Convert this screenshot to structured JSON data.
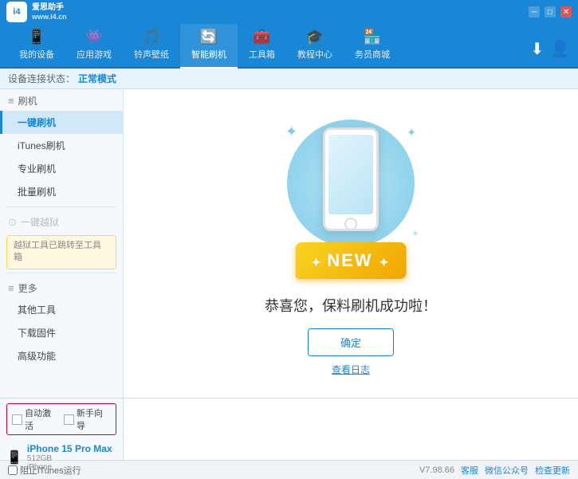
{
  "titleBar": {
    "logoText1": "爱思助手",
    "logoText2": "www.i4.cn",
    "logoCode": "i4",
    "controls": [
      "minimize",
      "maximize",
      "close"
    ]
  },
  "nav": {
    "items": [
      {
        "id": "my-device",
        "icon": "📱",
        "label": "我的设备"
      },
      {
        "id": "apps-games",
        "icon": "🎮",
        "label": "应用游戏"
      },
      {
        "id": "ringtones",
        "icon": "🎵",
        "label": "铃声壁纸"
      },
      {
        "id": "smart-flash",
        "icon": "🔄",
        "label": "智能刷机",
        "active": true
      },
      {
        "id": "toolbox",
        "icon": "🧰",
        "label": "工具箱"
      },
      {
        "id": "tutorials",
        "icon": "🎓",
        "label": "教程中心"
      },
      {
        "id": "service",
        "icon": "🏪",
        "label": "务员商城"
      }
    ],
    "rightIcons": [
      "download",
      "user"
    ]
  },
  "statusBar": {
    "label": "设备连接状态：",
    "value": "正常模式"
  },
  "sidebar": {
    "sections": [
      {
        "header": "刷机",
        "items": [
          {
            "id": "one-click-flash",
            "label": "一键刷机",
            "active": true
          },
          {
            "id": "itunes-flash",
            "label": "iTunes刷机"
          },
          {
            "id": "pro-flash",
            "label": "专业刷机"
          },
          {
            "id": "batch-flash",
            "label": "批量刷机"
          }
        ]
      },
      {
        "header": "一键越狱",
        "disabled": true,
        "notice": "越狱工具已跳转至工具箱"
      },
      {
        "header": "更多",
        "items": [
          {
            "id": "other-tools",
            "label": "其他工具"
          },
          {
            "id": "download-firmware",
            "label": "下载固件"
          },
          {
            "id": "advanced",
            "label": "高级功能"
          }
        ]
      }
    ]
  },
  "content": {
    "successText": "恭喜您，保料刷机成功啦！",
    "confirmButton": "确定",
    "logLink": "查看日志",
    "newBadgeText": "NEW",
    "phone": {
      "altText": "phone illustration"
    }
  },
  "bottomPanel": {
    "checkboxes": [
      {
        "id": "auto-activate",
        "label": "自动激活"
      },
      {
        "id": "guide",
        "label": "新手向导"
      }
    ],
    "device": {
      "name": "iPhone 15 Pro Max",
      "storage": "512GB",
      "type": "iPhone"
    }
  },
  "footer": {
    "itunes": "阻止iTunes运行",
    "version": "V7.98.66",
    "links": [
      "客服",
      "微信公众号",
      "检查更新"
    ]
  }
}
